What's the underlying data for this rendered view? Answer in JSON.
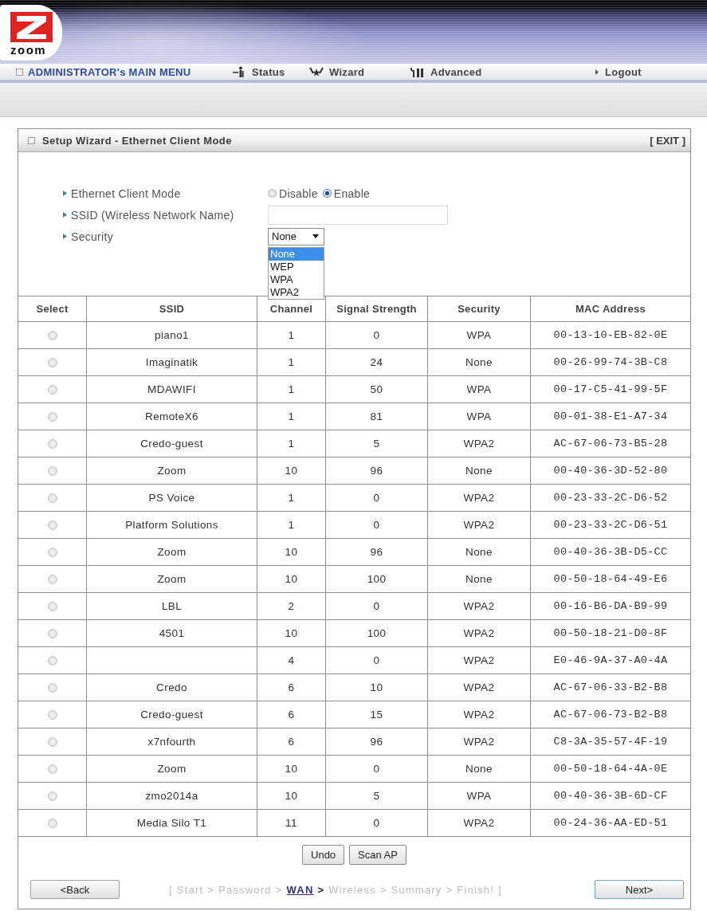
{
  "header": {
    "logo_text": "zoom",
    "menu_title": "ADMINISTRATOR's MAIN MENU",
    "nav": [
      {
        "label": "Status",
        "kind": "status"
      },
      {
        "label": "Wizard",
        "kind": "wizard"
      },
      {
        "label": "Advanced",
        "kind": "advanced"
      },
      {
        "label": "Logout",
        "kind": "logout"
      }
    ]
  },
  "panel": {
    "title": "Setup Wizard - Ethernet Client Mode",
    "exit": "[ EXIT ]"
  },
  "form": {
    "mode": {
      "label": "Ethernet Client Mode",
      "options": [
        {
          "label": "Disable",
          "selected": false
        },
        {
          "label": "Enable",
          "selected": true
        }
      ]
    },
    "ssid": {
      "label": "SSID (Wireless Network Name)"
    },
    "security": {
      "label": "Security",
      "value": "None",
      "expanded": true,
      "options": [
        {
          "label": "None",
          "selected": true
        },
        {
          "label": "WEP",
          "selected": false
        },
        {
          "label": "WPA",
          "selected": false
        },
        {
          "label": "WPA2",
          "selected": false
        }
      ]
    }
  },
  "table": {
    "columns": [
      "Select",
      "SSID",
      "Channel",
      "Signal Strength",
      "Security",
      "MAC Address"
    ],
    "rows": [
      {
        "selected": false,
        "ssid": "piano1",
        "channel": "1",
        "signal": "0",
        "security": "WPA",
        "mac": "00-13-10-EB-82-0E"
      },
      {
        "selected": false,
        "ssid": "Imaginatik",
        "channel": "1",
        "signal": "24",
        "security": "None",
        "mac": "00-26-99-74-3B-C8"
      },
      {
        "selected": false,
        "ssid": "MDAWIFI",
        "channel": "1",
        "signal": "50",
        "security": "WPA",
        "mac": "00-17-C5-41-99-5F"
      },
      {
        "selected": false,
        "ssid": "RemoteX6",
        "channel": "1",
        "signal": "81",
        "security": "WPA",
        "mac": "00-01-38-E1-A7-34"
      },
      {
        "selected": false,
        "ssid": "Credo-guest",
        "channel": "1",
        "signal": "5",
        "security": "WPA2",
        "mac": "AC-67-06-73-B5-28"
      },
      {
        "selected": false,
        "ssid": "Zoom",
        "channel": "10",
        "signal": "96",
        "security": "None",
        "mac": "00-40-36-3D-52-80"
      },
      {
        "selected": false,
        "ssid": "PS Voice",
        "channel": "1",
        "signal": "0",
        "security": "WPA2",
        "mac": "00-23-33-2C-D6-52"
      },
      {
        "selected": false,
        "ssid": "Platform Solutions",
        "channel": "1",
        "signal": "0",
        "security": "WPA2",
        "mac": "00-23-33-2C-D6-51"
      },
      {
        "selected": false,
        "ssid": "Zoom",
        "channel": "10",
        "signal": "96",
        "security": "None",
        "mac": "00-40-36-3B-D5-CC"
      },
      {
        "selected": false,
        "ssid": "Zoom",
        "channel": "10",
        "signal": "100",
        "security": "None",
        "mac": "00-50-18-64-49-E6"
      },
      {
        "selected": false,
        "ssid": "LBL",
        "channel": "2",
        "signal": "0",
        "security": "WPA2",
        "mac": "00-16-B6-DA-B9-99"
      },
      {
        "selected": false,
        "ssid": "4501",
        "channel": "10",
        "signal": "100",
        "security": "WPA2",
        "mac": "00-50-18-21-D0-8F"
      },
      {
        "selected": false,
        "channel": "4",
        "signal": "0",
        "security": "WPA2",
        "mac": "E0-46-9A-37-A0-4A"
      },
      {
        "selected": false,
        "ssid": "Credo",
        "channel": "6",
        "signal": "10",
        "security": "WPA2",
        "mac": "AC-67-06-33-B2-B8"
      },
      {
        "selected": false,
        "ssid": "Credo-guest",
        "channel": "6",
        "signal": "15",
        "security": "WPA2",
        "mac": "AC-67-06-73-B2-B8"
      },
      {
        "selected": false,
        "ssid": "x7nfourth",
        "channel": "6",
        "signal": "96",
        "security": "WPA2",
        "mac": "C8-3A-35-57-4F-19"
      },
      {
        "selected": false,
        "ssid": "Zoom",
        "channel": "10",
        "signal": "0",
        "security": "None",
        "mac": "00-50-18-64-4A-0E"
      },
      {
        "selected": false,
        "ssid": "zmo2014a",
        "channel": "10",
        "signal": "5",
        "security": "WPA",
        "mac": "00-40-36-3B-6D-CF"
      },
      {
        "selected": false,
        "ssid": "Media Silo T1",
        "channel": "11",
        "signal": "0",
        "security": "WPA2",
        "mac": "00-24-36-AA-ED-51"
      }
    ]
  },
  "actions": [
    "Undo",
    "Scan AP"
  ],
  "navigation": {
    "back": "<Back",
    "next": "Next>",
    "steps": {
      "open": "[",
      "close": "]",
      "separator": ">",
      "items": [
        {
          "label": "Start",
          "selected": false
        },
        {
          "label": "Password",
          "selected": false
        },
        {
          "label": "WAN",
          "selected": true
        },
        {
          "label": "Wireless",
          "selected": false
        },
        {
          "label": "Summary",
          "selected": false
        },
        {
          "label": "Finish!",
          "selected": false
        }
      ]
    }
  }
}
